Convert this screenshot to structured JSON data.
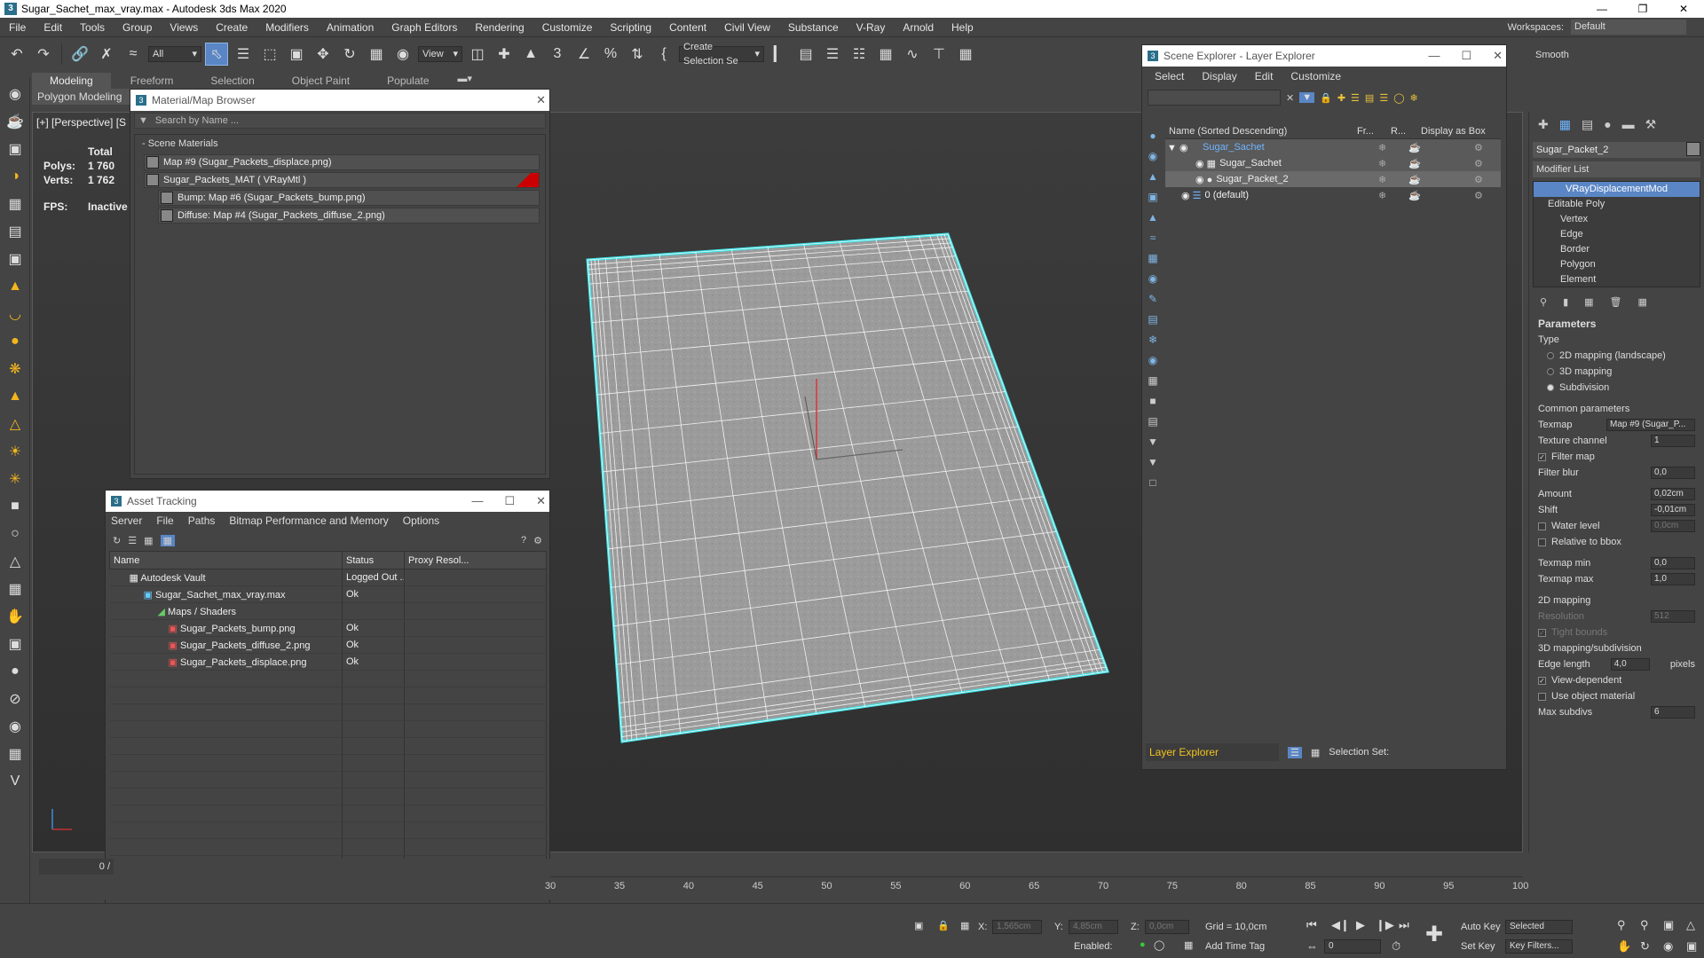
{
  "window": {
    "title": "Sugar_Sachet_max_vray.max - Autodesk 3ds Max 2020",
    "icon_label": "3"
  },
  "menubar": {
    "items": [
      "File",
      "Edit",
      "Tools",
      "Group",
      "Views",
      "Create",
      "Modifiers",
      "Animation",
      "Graph Editors",
      "Rendering",
      "Customize",
      "Scripting",
      "Content",
      "Civil View",
      "Substance",
      "V-Ray",
      "Arnold",
      "Help"
    ],
    "workspaces_label": "Workspaces:",
    "workspace_value": "Default"
  },
  "toolbar": {
    "selection_filter": "All",
    "ref_coord": "View",
    "selection_set": "Create Selection Se",
    "smooth_label": "Smooth"
  },
  "ribbon": {
    "tabs": [
      "Modeling",
      "Freeform",
      "Selection",
      "Object Paint",
      "Populate"
    ],
    "sub_label": "Polygon Modeling"
  },
  "viewport": {
    "label": "[+] [Perspective] [S",
    "stats_total": "Total",
    "polys_label": "Polys:",
    "polys_value": "1 760",
    "verts_label": "Verts:",
    "verts_value": "1 762",
    "fps_label": "FPS:",
    "fps_value": "Inactive"
  },
  "material_browser": {
    "title": "Material/Map Browser",
    "search_placeholder": "Search by Name ...",
    "section": "- Scene Materials",
    "items": [
      "Map #9 (Sugar_Packets_displace.png)",
      "Sugar_Packets_MAT  ( VRayMtl )",
      "Bump: Map #6 (Sugar_Packets_bump.png)",
      "Diffuse: Map #4 (Sugar_Packets_diffuse_2.png)"
    ]
  },
  "asset_tracking": {
    "title": "Asset Tracking",
    "menu": [
      "Server",
      "File",
      "Paths",
      "Bitmap Performance and Memory",
      "Options"
    ],
    "columns": [
      "Name",
      "Status",
      "Proxy Resol..."
    ],
    "rows": [
      {
        "name": "Autodesk Vault",
        "status": "Logged Out ...",
        "proxy": ""
      },
      {
        "name": "Sugar_Sachet_max_vray.max",
        "status": "Ok",
        "proxy": ""
      },
      {
        "name": "Maps / Shaders",
        "status": "",
        "proxy": ""
      },
      {
        "name": "Sugar_Packets_bump.png",
        "status": "Ok",
        "proxy": ""
      },
      {
        "name": "Sugar_Packets_diffuse_2.png",
        "status": "Ok",
        "proxy": ""
      },
      {
        "name": "Sugar_Packets_displace.png",
        "status": "Ok",
        "proxy": ""
      }
    ],
    "command_value": "outlinerNest"
  },
  "scene_explorer": {
    "title": "Scene Explorer - Layer Explorer",
    "menu": [
      "Select",
      "Display",
      "Edit",
      "Customize"
    ],
    "col_name": "Name (Sorted Descending)",
    "col_freeze": "Fr...",
    "col_render": "R...",
    "col_box": "Display as Box",
    "tree": [
      {
        "name": "Sugar_Sachet",
        "level": 0
      },
      {
        "name": "Sugar_Sachet",
        "level": 1
      },
      {
        "name": "Sugar_Packet_2",
        "level": 1
      },
      {
        "name": "0 (default)",
        "level": 0
      }
    ],
    "explorer_mode": "Layer Explorer",
    "selection_set_label": "Selection Set:"
  },
  "command_panel": {
    "object_name": "Sugar_Packet_2",
    "modifier_list": "Modifier List",
    "stack": [
      "VRayDisplacementMod",
      "Editable Poly",
      "Vertex",
      "Edge",
      "Border",
      "Polygon",
      "Element"
    ],
    "parameters_title": "Parameters",
    "type_label": "Type",
    "type_options": [
      "2D mapping (landscape)",
      "3D mapping",
      "Subdivision"
    ],
    "common_label": "Common parameters",
    "texmap_label": "Texmap",
    "texmap_value": "Map #9 (Sugar_P...",
    "texchannel_label": "Texture channel",
    "texchannel_value": "1",
    "filter_map": "Filter map",
    "filter_blur_label": "Filter blur",
    "filter_blur_value": "0,0",
    "amount_label": "Amount",
    "amount_value": "0,02cm",
    "shift_label": "Shift",
    "shift_value": "-0,01cm",
    "water_label": "Water level",
    "water_value": "0,0cm",
    "relative_label": "Relative to bbox",
    "texmin_label": "Texmap min",
    "texmin_value": "0,0",
    "texmax_label": "Texmap max",
    "texmax_value": "1,0",
    "map2d_label": "2D mapping",
    "resolution_label": "Resolution",
    "resolution_value": "512",
    "tight_label": "Tight bounds",
    "map3d_label": "3D mapping/subdivision",
    "edge_len_label": "Edge length",
    "edge_len_value": "4,0",
    "pixels_label": "pixels",
    "view_dep": "View-dependent",
    "use_obj": "Use object material",
    "max_subdivs_label": "Max subdivs",
    "max_subdivs_value": "6"
  },
  "timeline": {
    "frame_value": "0 /",
    "ticks": [
      "30",
      "35",
      "40",
      "45",
      "50",
      "55",
      "60",
      "65",
      "70",
      "75",
      "80",
      "85",
      "90",
      "95",
      "100"
    ]
  },
  "statusbar": {
    "x_label": "X:",
    "x_value": "1,565cm",
    "y_label": "Y:",
    "y_value": "4,85cm",
    "z_label": "Z:",
    "z_value": "0,0cm",
    "grid": "Grid = 10,0cm",
    "enabled_label": "Enabled:",
    "add_time_tag": "Add Time Tag",
    "auto_key": "Auto Key",
    "set_key": "Set Key",
    "selected": "Selected",
    "key_filters": "Key Filters...",
    "frame_field": "0"
  }
}
